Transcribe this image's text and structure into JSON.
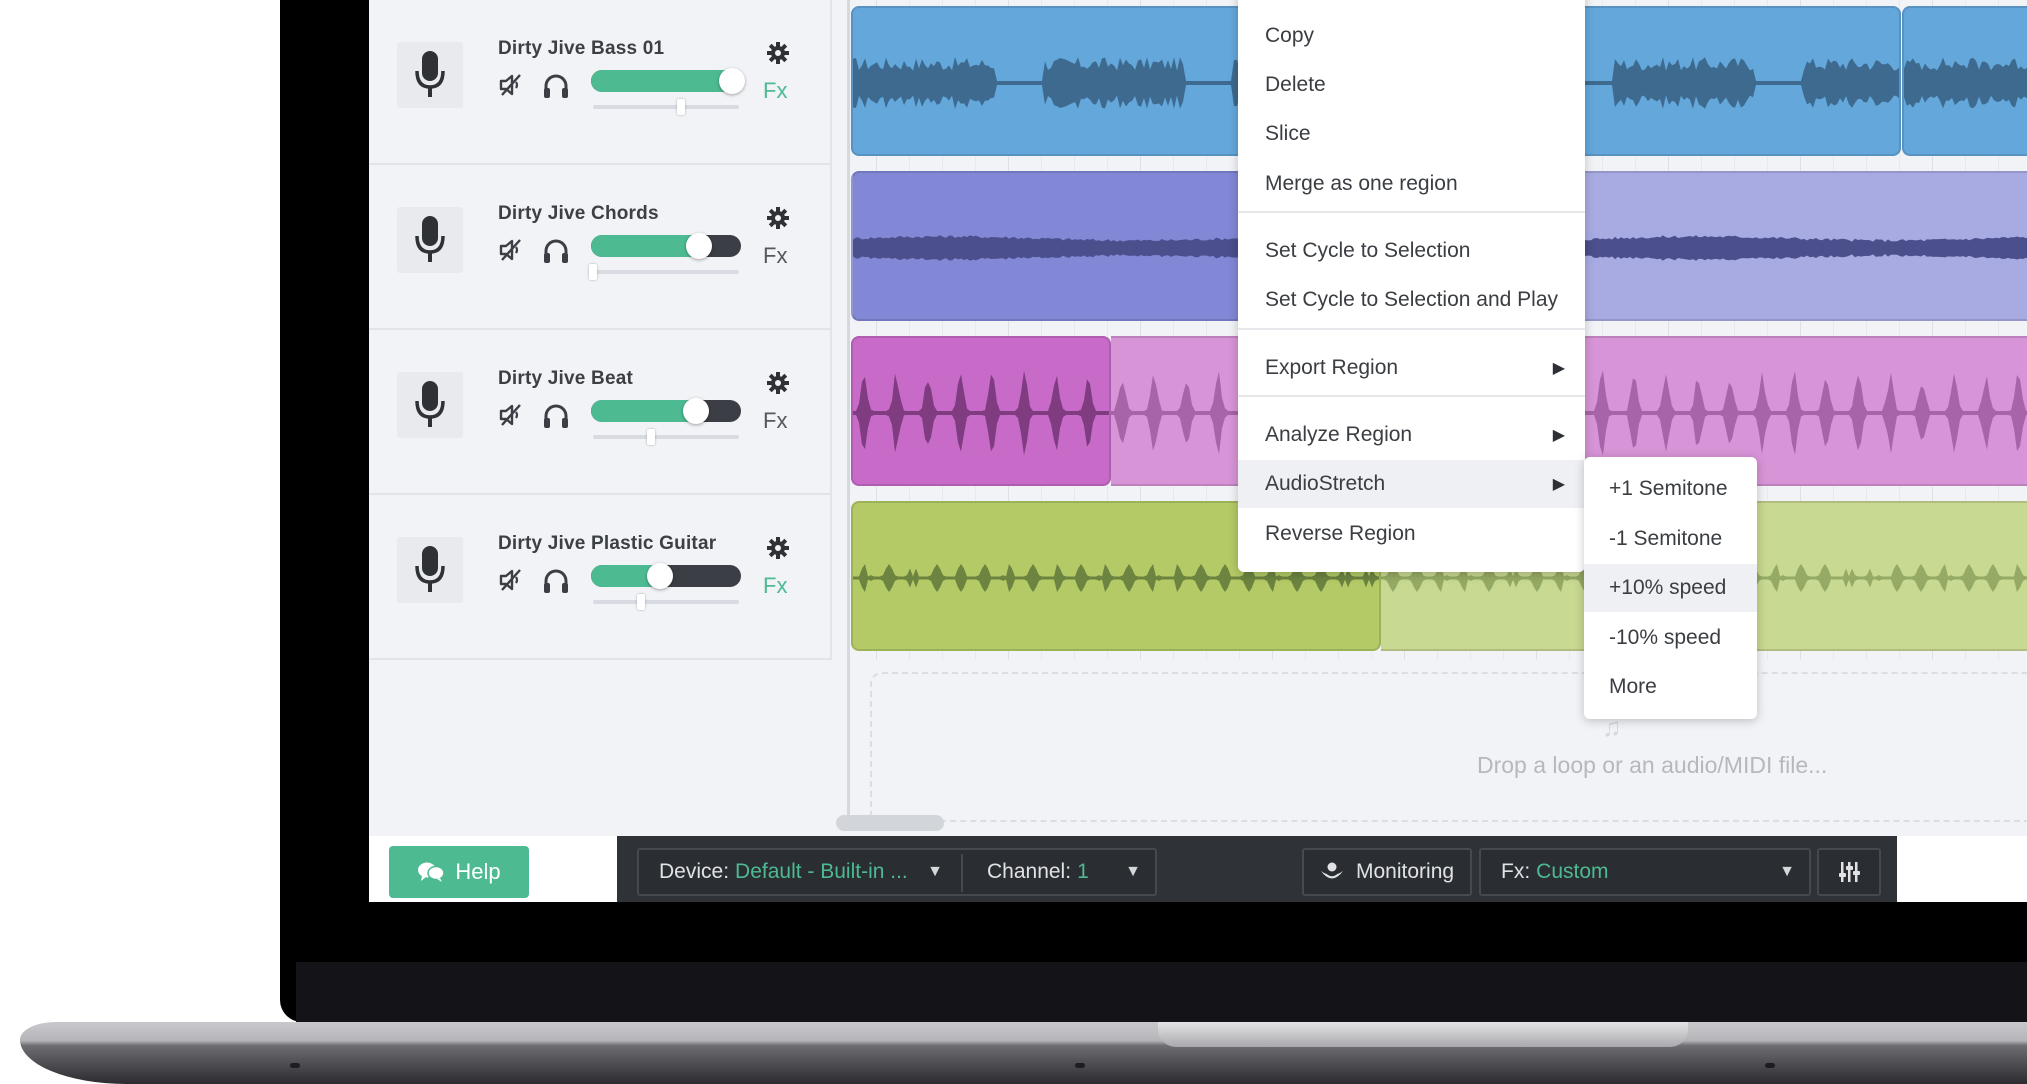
{
  "tracks": [
    {
      "name": "Dirty Jive Bass 01",
      "volume": 0.94,
      "pan": 0.6,
      "fx_label": "Fx",
      "fx_active": true,
      "region_color": "#63a7db",
      "wave_color": "#3d6a8e"
    },
    {
      "name": "Dirty Jive Chords",
      "volume": 0.72,
      "pan": 0.0,
      "fx_label": "Fx",
      "fx_active": false,
      "region_color": "#8287d6",
      "wave_color": "#4b4f8c"
    },
    {
      "name": "Dirty Jive Beat",
      "volume": 0.7,
      "pan": 0.4,
      "fx_label": "Fx",
      "fx_active": false,
      "region_color": "#c86ac8",
      "wave_color": "#7f3c80"
    },
    {
      "name": "Dirty Jive Plastic Guitar",
      "volume": 0.46,
      "pan": 0.33,
      "fx_label": "Fx",
      "fx_active": true,
      "region_color": "#b3ca66",
      "wave_color": "#6c8440"
    }
  ],
  "context_menu": {
    "items": [
      {
        "label": "Copy"
      },
      {
        "label": "Delete"
      },
      {
        "label": "Slice"
      },
      {
        "label": "Merge as one region"
      },
      {
        "label": "Set Cycle to Selection"
      },
      {
        "label": "Set Cycle to Selection and Play"
      },
      {
        "label": "Export Region",
        "submenu": true
      },
      {
        "label": "Analyze Region",
        "submenu": true
      },
      {
        "label": "AudioStretch",
        "submenu": true,
        "highlighted": true
      },
      {
        "label": "Reverse Region"
      }
    ],
    "arrow_glyph": "▶"
  },
  "submenu": {
    "items": [
      {
        "label": "+1 Semitone"
      },
      {
        "label": "-1 Semitone"
      },
      {
        "label": "+10% speed",
        "highlighted": true
      },
      {
        "label": "-10% speed"
      },
      {
        "label": "More"
      }
    ]
  },
  "dropzone": {
    "text": "Drop a loop or an audio/MIDI file...",
    "icon": "music-note-icon"
  },
  "bottom_bar": {
    "help_label": "Help",
    "device_label": "Device:",
    "device_value": "Default - Built-in ...",
    "channel_label": "Channel:",
    "channel_value": "1",
    "monitoring_label": "Monitoring",
    "fx_label": "Fx:",
    "fx_value": "Custom",
    "caret": "▼"
  },
  "colors": {
    "accent": "#4dba92",
    "toolbar_bg": "#2f3237"
  }
}
